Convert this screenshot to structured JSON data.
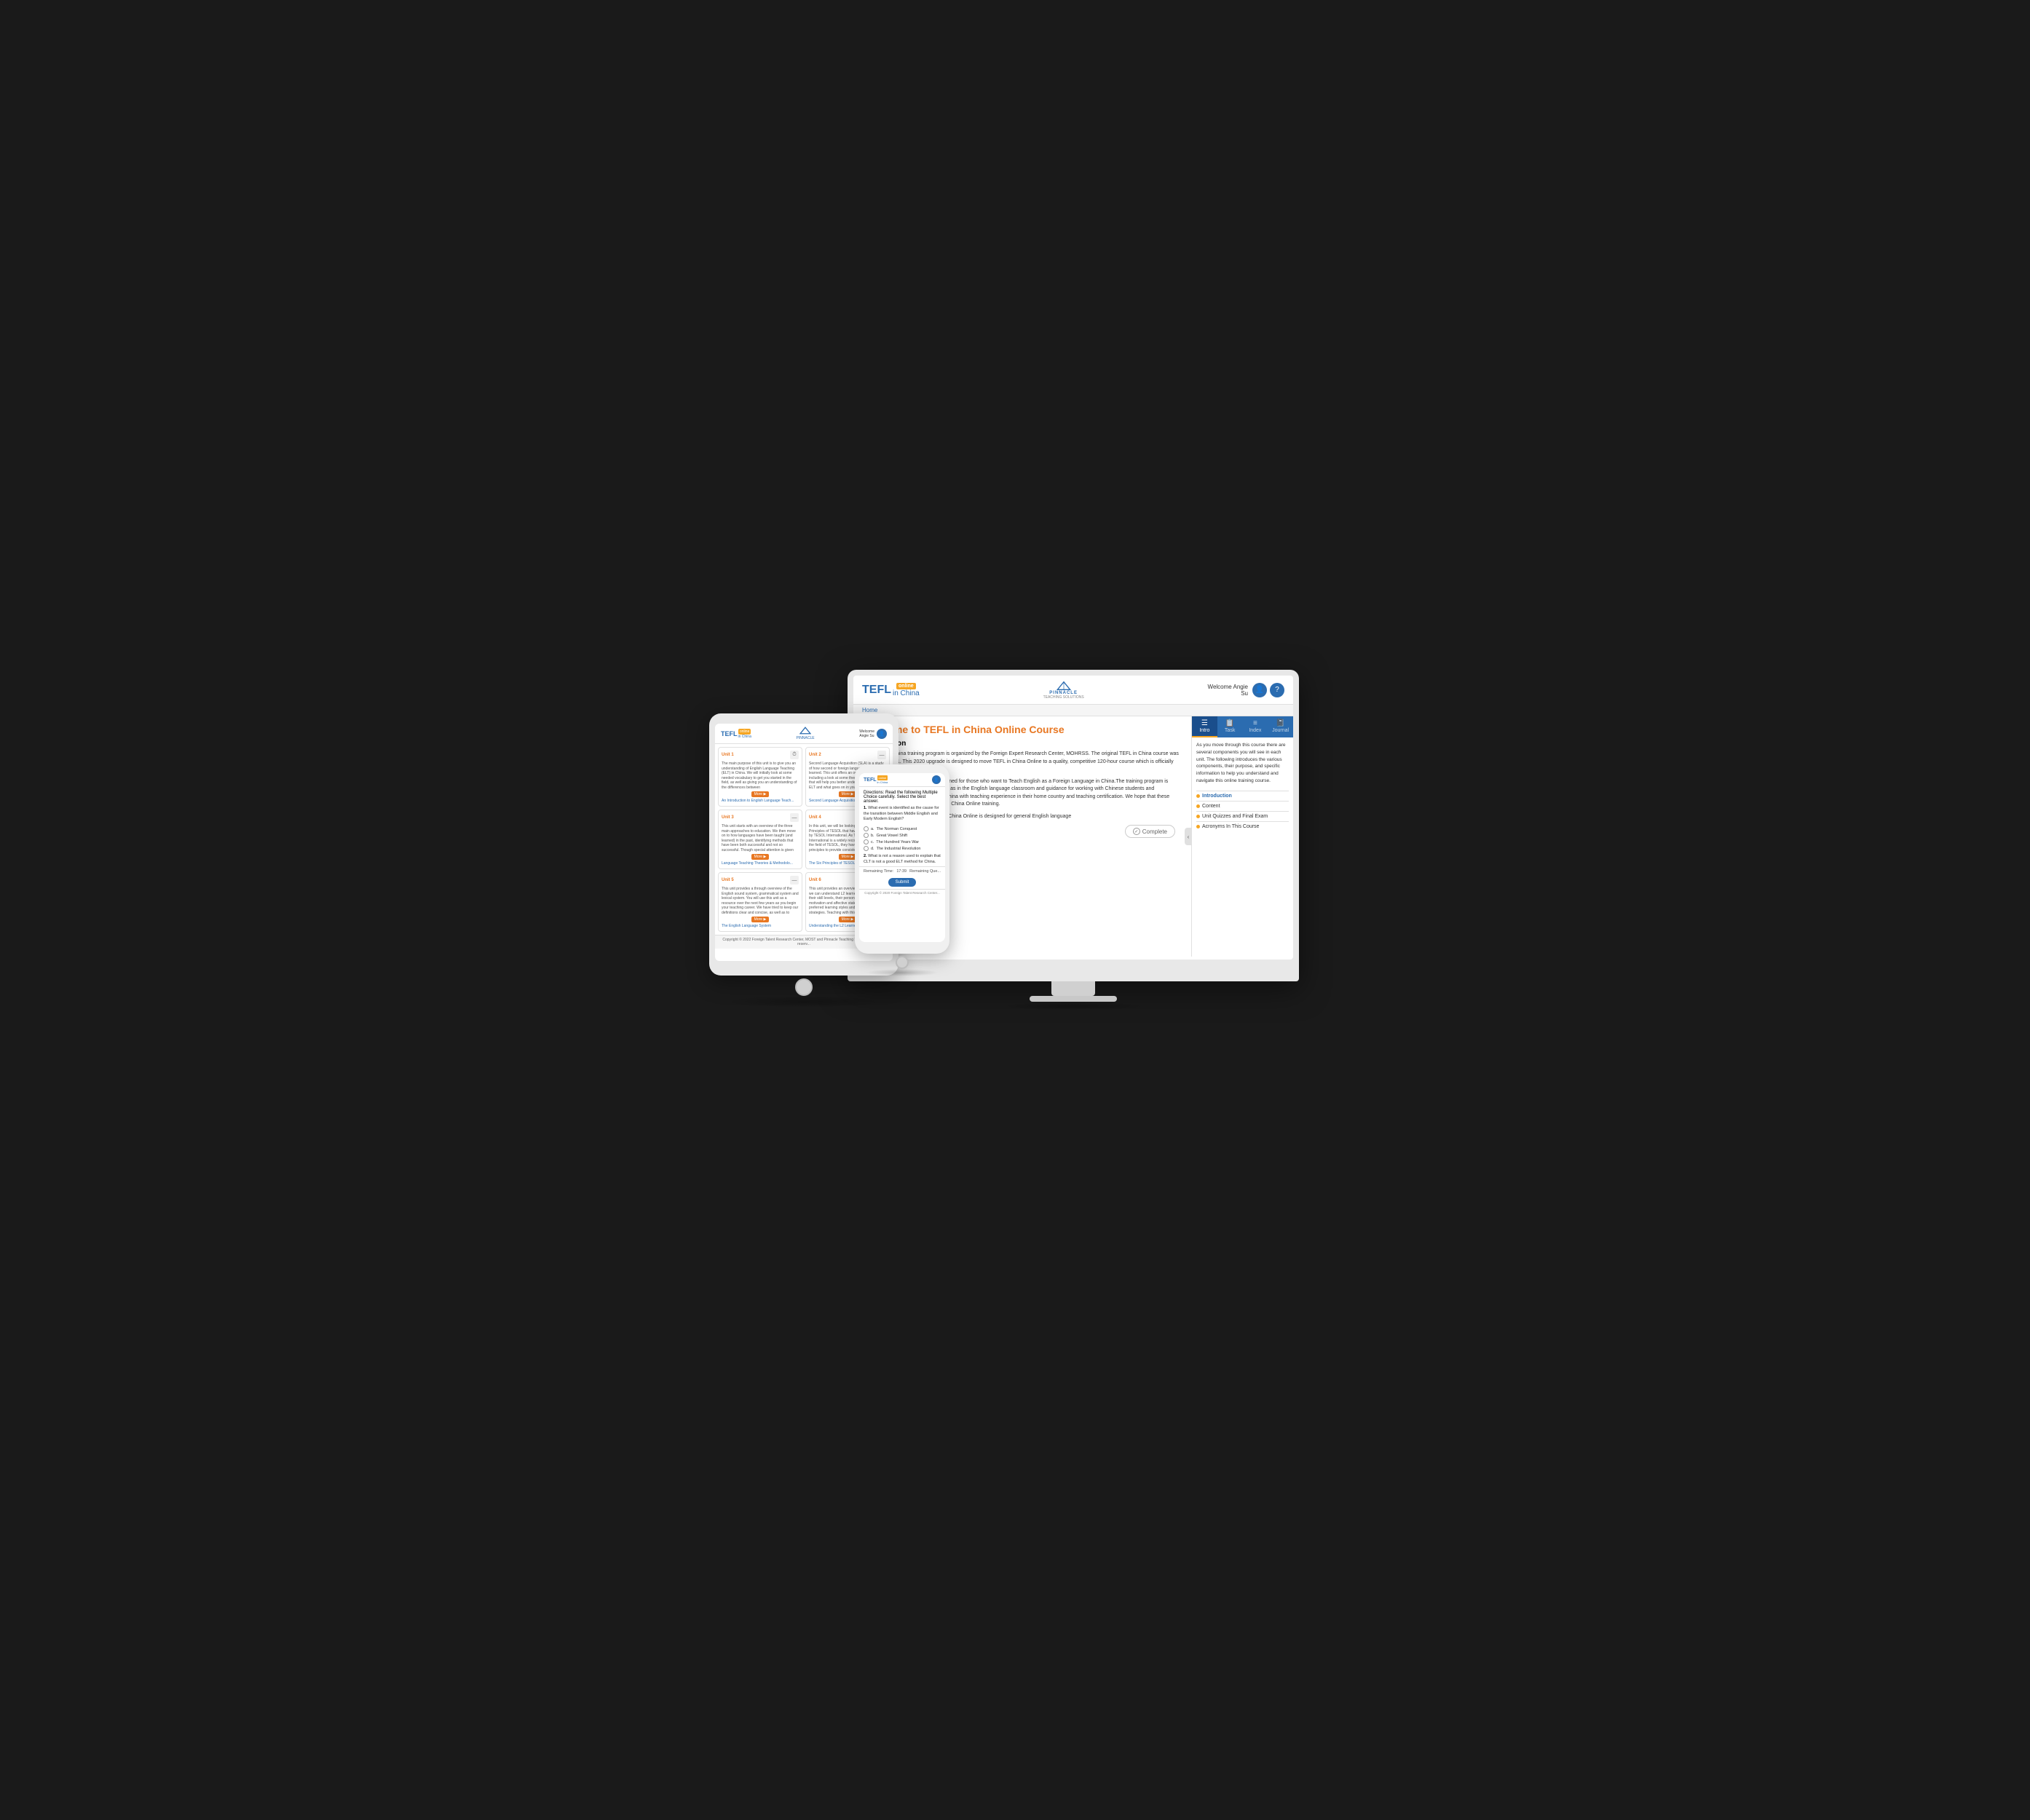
{
  "scene": {
    "background_color": "#1a1a1a"
  },
  "desktop": {
    "header": {
      "tefl_logo": "TEFL",
      "online_badge": "online",
      "in_china": "in China",
      "pinnacle_name": "PINNACLE",
      "pinnacle_sub": "TEACHING SOLUTIONS",
      "welcome": "Welcome Angie",
      "user_sub": "Su",
      "user_icon": "👤",
      "help_icon": "?"
    },
    "breadcrumb": "Home",
    "main": {
      "title": "Welcome to TEFL in China Online Course",
      "intro_heading": "Introduction",
      "paragraph1": "The TEFL in China training program is organized by the Foreign Expert Research Center, MOHRSS. The original TEFL in China course was updated in 2011. This 2020 upgrade is designed to move TEFL in China Online to a quality, competitive 120-hour course which is officially recognized throughout China.",
      "paragraph2": "TEFL in China Online training is designed for those who want to Teach English as a Foreign Language in China.The training program is about how to teach in general, as well as in the English language classroom and guidance for working with Chinese students and institutions. Many teachers come to China with teaching experience in their home country and teaching certification. We hope that these teachers also will benefit from TEFL in China Online training.",
      "paragraph3": "The core training program of TEFL in China Online is designed for general English language"
    },
    "complete_button": "Complete",
    "right_panel": {
      "tabs": [
        {
          "id": "intro",
          "label": "Intro",
          "icon": "☰",
          "active": true
        },
        {
          "id": "task",
          "label": "Task",
          "icon": "📋",
          "active": false
        },
        {
          "id": "index",
          "label": "Index",
          "icon": "≡",
          "active": false
        },
        {
          "id": "journal",
          "label": "Journal",
          "icon": "📓",
          "active": false
        }
      ],
      "intro_text": "As you move through this course there are several components you will see in each unit. The following introduces the various components, their purpose, and specific information to help you understand and navigate this online training course.",
      "list_items": [
        {
          "label": "Introduction",
          "active": true
        },
        {
          "label": "Content",
          "active": false
        },
        {
          "label": "Unit Quizzes and Final Exam",
          "active": false
        },
        {
          "label": "Acronyms In This Course",
          "active": false
        }
      ]
    }
  },
  "tablet": {
    "header": {
      "tefl_logo": "TEFL",
      "online_badge": "online",
      "in_china": "in China",
      "pinnacle_name": "PINNACLE",
      "welcome": "Welcome",
      "user_sub": "Angie Su",
      "user_icon": "👤"
    },
    "units": [
      {
        "id": "Unit 1",
        "icon": "⏱",
        "desc": "The main purpose of this unit is to give you an understanding of English Language Teaching (ELT) in China. We will initially look at some needed vocabulary to get you started in the field, as well as giving you an understanding of the differences between",
        "more": "More ▶",
        "link": "An Introduction to English Language Teach..."
      },
      {
        "id": "Unit 2",
        "icon": "—",
        "desc": "Second Language Acquisition (SLA) is a study of how second or foreign languages are learned. This unit offers an overview of SLA, including a look at some theories and models that will help you better understand the field of ELT and what goes on in your classrooms.",
        "more": "More ▶",
        "link": "Second Language Acquisition Theories"
      },
      {
        "id": "Unit 3",
        "icon": "—",
        "desc": "This unit starts with an overview of the three main approaches to education. We then move on to how languages have been taught (and learned) in the past, identifying methods that have been both successful and not so successful. Though special attention is given",
        "more": "More ▶",
        "link": "Language Teaching Theories & Methodolo..."
      },
      {
        "id": "Unit 4",
        "icon": "—",
        "desc": "In this unit, we will be looking at the Six Principles of TESOL that have been developed by TESOL International. As TESOL International is a widely recognized leader in the field of TESOL, they have developed these principles to provide consistency across the",
        "more": "More ▶",
        "link": "The Six Principles of TESOL"
      },
      {
        "id": "Unit 5",
        "icon": "—",
        "desc": "This unit provides a through overview of the English sound system, grammatical system and lexical system. You will use this unit as a resource over the next few years as you begin your teaching career. We have tried to keep our definitions clear and concise, as well as to",
        "more": "More ▶",
        "link": "The English Language System"
      },
      {
        "id": "Unit 6",
        "icon": "—",
        "desc": "This unit provides an overview of ways in which we can understand L2 learners according to their skill levels, their personality traits, their motivation and affective state, and their preferred learning styles and learning strategies. Teaching with this knowledge, we",
        "more": "More ▶",
        "link": "Understanding the L2 Learner"
      }
    ],
    "footer": "Copyright © 2022 Foreign Talent Research Center, MOST and Pinnacle Teaching Solutions. All rights reserv..."
  },
  "phone": {
    "header": {
      "tefl_logo": "TEFL",
      "online_badge": "online",
      "in_china": "in China",
      "user_icon": "👤"
    },
    "directions_label": "Directions:",
    "directions_text": "Read the following Multiple Choice carefully. Select the best answer.",
    "question1": {
      "num": "1.",
      "text": "What event is identified as the cause for the transition between Middle English and Early Modern English?",
      "options": [
        {
          "letter": "a.",
          "text": "The Norman Conquest"
        },
        {
          "letter": "b.",
          "text": "Great Vowel Shift"
        },
        {
          "letter": "c.",
          "text": "The Hundred Years War"
        },
        {
          "letter": "d.",
          "text": "The Industrial Revolution"
        }
      ]
    },
    "question2": {
      "num": "2.",
      "text": "What is not a reason used to explain that CLT is not a good ELT method for China."
    },
    "timer_label": "Remaining Time:",
    "timer_value": "17:39",
    "questions_label": "Remaining Que...",
    "submit_button": "Submit",
    "footer": "Copyright © 2020 Foreign Talent Research Center..."
  }
}
